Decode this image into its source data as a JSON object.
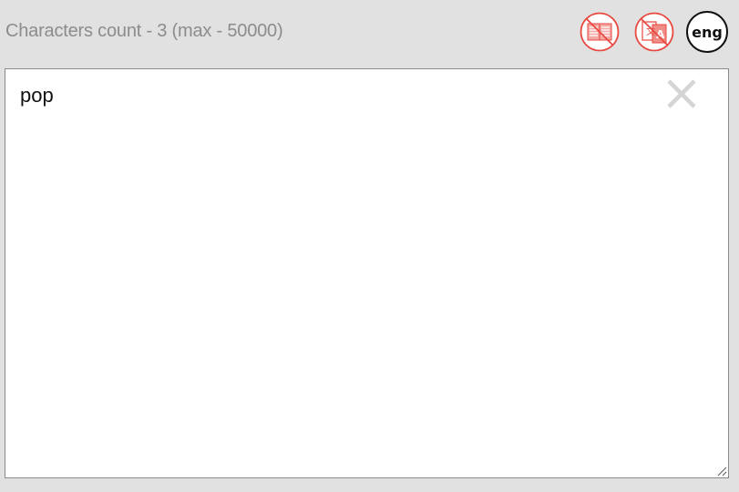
{
  "header": {
    "char_count_text": "Characters count - 3 (max - 50000)"
  },
  "toolbar": {
    "dictionary_icon": "dictionary-off-icon",
    "translate_icon": "translate-off-icon",
    "language_label": "eng",
    "disabled_color": "#e8483f"
  },
  "editor": {
    "value": "pop",
    "clear_icon": "close-icon"
  }
}
